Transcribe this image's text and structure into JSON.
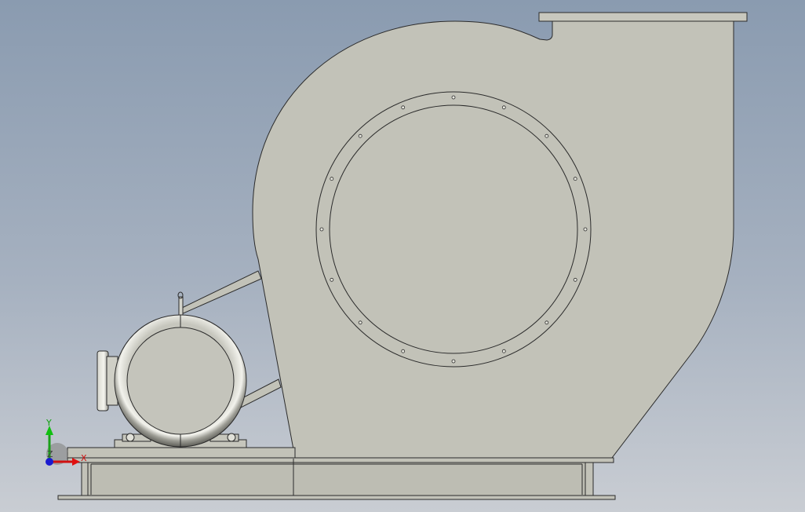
{
  "viewport": {
    "background_top": "#8a9bb0",
    "background_bottom": "#c9cdd3"
  },
  "model": {
    "type": "centrifugal-fan-assembly",
    "body_color": "#c2c2b8",
    "edge_color": "#2b2b2b",
    "flange_bolt_count": 16
  },
  "triad": {
    "x_label": "X",
    "y_label": "Y",
    "z_label": "Z",
    "x_color": "#e01010",
    "y_color": "#10c010",
    "z_color": "#1010e0"
  }
}
